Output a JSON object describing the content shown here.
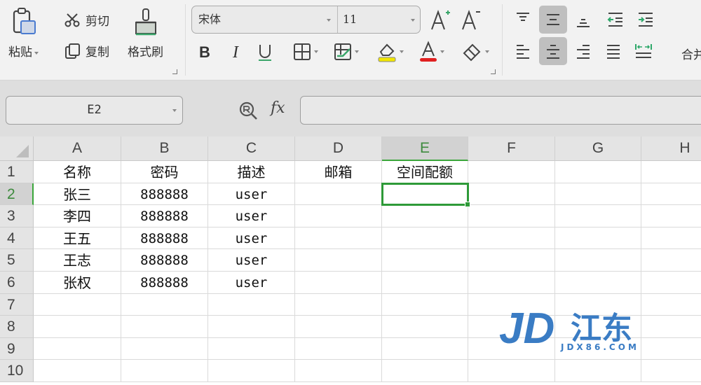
{
  "ribbon": {
    "clipboard": {
      "paste_label": "粘贴",
      "cut_label": "剪切",
      "copy_label": "复制",
      "format_painter_label": "格式刷"
    },
    "font": {
      "font_name": "宋体",
      "font_size": "11",
      "underline_color": "#3aa66a",
      "highlight_color": "#f2e600",
      "font_color": "#e02020"
    },
    "alignment": {
      "active_vertical": "middle",
      "active_horizontal": "center"
    },
    "merge_label": "合并"
  },
  "formula_bar": {
    "name_box": "E2",
    "fx_label": "fx",
    "formula_value": ""
  },
  "sheet": {
    "selected_cell": "E2",
    "columns": [
      "A",
      "B",
      "C",
      "D",
      "E",
      "F",
      "G",
      "H"
    ],
    "rows": [
      "1",
      "2",
      "3",
      "4",
      "5",
      "6",
      "7",
      "8",
      "9",
      "10"
    ],
    "cells": [
      [
        "名称",
        "密码",
        "描述",
        "邮箱",
        "空间配额",
        "",
        "",
        ""
      ],
      [
        "张三",
        "888888",
        "user",
        "",
        "",
        "",
        "",
        ""
      ],
      [
        "李四",
        "888888",
        "user",
        "",
        "",
        "",
        "",
        ""
      ],
      [
        "王五",
        "888888",
        "user",
        "",
        "",
        "",
        "",
        ""
      ],
      [
        "王志",
        "888888",
        "user",
        "",
        "",
        "",
        "",
        ""
      ],
      [
        "张权",
        "888888",
        "user",
        "",
        "",
        "",
        "",
        ""
      ],
      [
        "",
        "",
        "",
        "",
        "",
        "",
        "",
        ""
      ],
      [
        "",
        "",
        "",
        "",
        "",
        "",
        "",
        ""
      ],
      [
        "",
        "",
        "",
        "",
        "",
        "",
        "",
        ""
      ],
      [
        "",
        "",
        "",
        "",
        "",
        "",
        "",
        ""
      ]
    ]
  },
  "watermark": {
    "logo_text": "JD",
    "brand_text": "江东",
    "url_text": "JDX86.COM",
    "color": "#3a7cc4"
  }
}
